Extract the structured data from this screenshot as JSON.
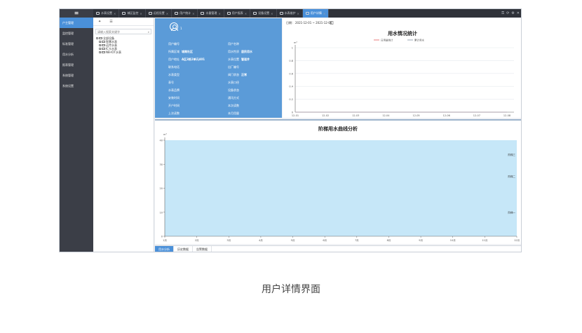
{
  "sidebar": {
    "menu_icon": "menu-icon",
    "items": [
      {
        "label": "户主管理",
        "active": true
      },
      {
        "label": "监控管理",
        "active": false
      },
      {
        "label": "标准管理",
        "active": false
      },
      {
        "label": "用水分析",
        "active": false
      },
      {
        "label": "报表管理",
        "active": false
      },
      {
        "label": "系统管理",
        "active": false
      },
      {
        "label": "系统设置",
        "active": false
      }
    ]
  },
  "tabs": [
    {
      "label": "水表设置",
      "active": false
    },
    {
      "label": "城区监控",
      "active": false
    },
    {
      "label": "远程设置",
      "active": false
    },
    {
      "label": "用户统计",
      "active": false
    },
    {
      "label": "水量管理",
      "active": false
    },
    {
      "label": "用户报表",
      "active": false
    },
    {
      "label": "设备设置",
      "active": false
    },
    {
      "label": "水表维护",
      "active": false
    },
    {
      "label": "用户详情",
      "active": true
    }
  ],
  "window_controls": [
    "lock-icon",
    "refresh-icon",
    "settings-icon",
    "close-icon"
  ],
  "tree": {
    "search_placeholder": "请输入搜索关键字",
    "nodes": [
      {
        "label": "全部设备",
        "level": 0,
        "toggle": "−"
      },
      {
        "label": "智慧水表",
        "level": 1,
        "toggle": "+"
      },
      {
        "label": "远传水表",
        "level": 1,
        "toggle": "+"
      },
      {
        "label": "IC卡水表",
        "level": 1,
        "toggle": "+"
      },
      {
        "label": "NB-IOT水表",
        "level": 1,
        "toggle": "+"
      }
    ]
  },
  "user": {
    "avatar_tag": "1",
    "fields": [
      {
        "label": "用户编号",
        "value": ""
      },
      {
        "label": "所属区域",
        "value": "城南社区"
      },
      {
        "label": "用户地址",
        "value": "A区3栋2单元401"
      },
      {
        "label": "联系电话",
        "value": ""
      },
      {
        "label": "水表类型",
        "value": ""
      },
      {
        "label": "表号",
        "value": ""
      },
      {
        "label": "水表品牌",
        "value": ""
      },
      {
        "label": "安装时间",
        "value": ""
      },
      {
        "label": "开户时间",
        "value": ""
      },
      {
        "label": "上次读数",
        "value": ""
      },
      {
        "label": "用户名称",
        "value": ""
      },
      {
        "label": "用水性质",
        "value": "居民用水"
      },
      {
        "label": "水表位置",
        "value": "管道井"
      },
      {
        "label": "出厂编号",
        "value": ""
      },
      {
        "label": "阀门状态",
        "value": "正常"
      },
      {
        "label": "水表口径",
        "value": ""
      },
      {
        "label": "设备状态",
        "value": ""
      },
      {
        "label": "通讯方式",
        "value": ""
      },
      {
        "label": "本次读数",
        "value": ""
      },
      {
        "label": "本月用量",
        "value": ""
      }
    ]
  },
  "usage_chart": {
    "title": "用水情况统计",
    "date_prefix": "日期：",
    "date_range": "2021-12-01 ~ 2021-12-08",
    "legend": [
      "日用量统计",
      "累计用水"
    ],
    "legend_colors": [
      "#e87b7b",
      "#9aa7b5"
    ],
    "y_unit": "m³",
    "chart_data": {
      "type": "line",
      "x": [
        "12-01",
        "12-02",
        "12-03",
        "12-04",
        "12-05",
        "12-06",
        "12-07",
        "12-08"
      ],
      "series": [
        {
          "name": "日用量统计",
          "values": [
            0,
            0,
            0,
            0,
            0,
            0,
            0,
            0
          ]
        },
        {
          "name": "累计用水",
          "values": [
            0,
            0,
            0,
            0,
            0,
            0,
            0,
            0
          ]
        }
      ],
      "yticks": [
        "0",
        "0.2",
        "0.4",
        "0.6",
        "0.8",
        "1"
      ],
      "ylim": [
        0,
        1
      ]
    }
  },
  "tier_chart": {
    "title": "阶梯用水曲线分析",
    "y_unit": "m³",
    "fill_color": "#c6e7f8",
    "chart_data": {
      "type": "area",
      "x": [
        "1月",
        "2月",
        "3月",
        "4月",
        "5月",
        "6月",
        "7月",
        "8月",
        "9月",
        "10月",
        "11月",
        "12月"
      ],
      "yticks": [
        "0",
        "10",
        "20",
        "30",
        "40"
      ],
      "ylim": [
        0,
        40
      ],
      "annotations": [
        {
          "label": "阶梯三",
          "y": 34
        },
        {
          "label": "阶梯二",
          "y": 25
        },
        {
          "label": "阶梯一",
          "y": 10
        }
      ]
    }
  },
  "bottom_tabs": [
    {
      "label": "用水分析",
      "active": true
    },
    {
      "label": "历史数据",
      "active": false
    },
    {
      "label": "告警数据",
      "active": false
    }
  ],
  "caption": "用户详情界面"
}
